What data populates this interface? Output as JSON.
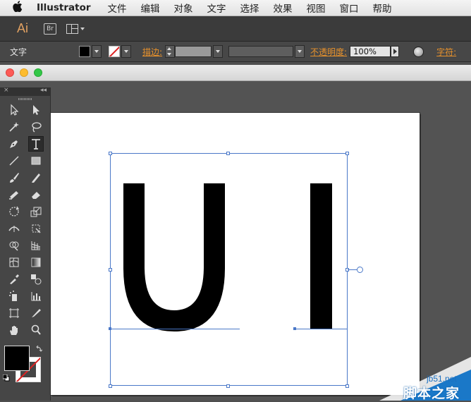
{
  "menubar": {
    "app_name": "Illustrator",
    "items": [
      "文件",
      "编辑",
      "对象",
      "文字",
      "选择",
      "效果",
      "视图",
      "窗口",
      "帮助"
    ]
  },
  "appbar": {
    "ai_logo": "Ai",
    "bridge_logo": "Br"
  },
  "control_bar": {
    "selection_type": "文字",
    "stroke_label": "描边:",
    "opacity_label": "不透明度:",
    "opacity_value": "100%",
    "character_label": "字符:"
  },
  "artwork": {
    "text": "U I",
    "fill_color": "#000000"
  },
  "tools_panel": {
    "close_label": "×",
    "collapse_label": "◂◂"
  },
  "watermark": {
    "domain": "jb51.net",
    "brand": "脚本之家"
  },
  "colors": {
    "selection": "#4a78c8",
    "accent_label": "#e8922c"
  }
}
